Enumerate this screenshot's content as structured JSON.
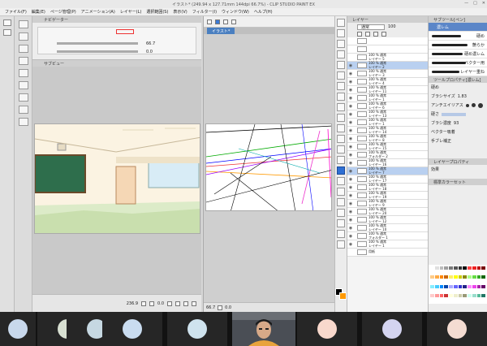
{
  "window": {
    "title": "イラスト* (249.94 x 127.71mm 144dpi 66.7%) - CLIP STUDIO PAINT EX",
    "controls": [
      "—",
      "□",
      "✕"
    ]
  },
  "menu": [
    "ファイル(F)",
    "編集(E)",
    "ページ管理(P)",
    "アニメーション(A)",
    "レイヤー(L)",
    "選択範囲(S)",
    "表示(V)",
    "フィルター(I)",
    "ウィンドウ(W)",
    "ヘルプ(H)"
  ],
  "navigator": {
    "tab_label": "ナビゲーター",
    "zoom_value": "66.7",
    "rotate_value": "0.0"
  },
  "sub_view": {
    "tab_label": "サブビュー",
    "zoom_value": "236.9",
    "rotate_value": "0.0"
  },
  "canvas": {
    "tab_label": "イラスト*",
    "zoom_value": "66.7",
    "rotate_value": "0.0"
  },
  "layers": {
    "panel_label": "レイヤー",
    "blend_mode": "通常",
    "opacity": "100",
    "rows": [
      {
        "eye": "",
        "icon": "",
        "text": ""
      },
      {
        "eye": "",
        "icon": "",
        "text": ""
      },
      {
        "eye": "",
        "icon": "",
        "text": "100 % 通常\nレイヤー 5",
        "sel": false
      },
      {
        "eye": "◉",
        "icon": "",
        "text": "100 % 通常\nレイヤー 2",
        "sel": true
      },
      {
        "eye": "◉",
        "icon": "",
        "text": "100 % 通常\nレイヤー 3",
        "sel": false
      },
      {
        "eye": "◉",
        "icon": "",
        "text": "100 % 通常\nレイヤー 4",
        "sel": false
      },
      {
        "eye": "◉",
        "icon": "",
        "text": "100 % 通常\nレイヤー 11",
        "sel": false
      },
      {
        "eye": "◉",
        "icon": "",
        "text": "100 % 通常\nレイヤー 1",
        "sel": false
      },
      {
        "eye": "◉",
        "icon": "",
        "text": "100 % 通常\nレイヤー 6",
        "sel": false
      },
      {
        "eye": "◉",
        "icon": "",
        "text": "100 % 通常\nレイヤー 13",
        "sel": false
      },
      {
        "eye": "◉",
        "icon": "",
        "text": "100 % 通常\nレイヤー 1",
        "sel": false
      },
      {
        "eye": "◉",
        "icon": "",
        "text": "100 % 通常\nレイヤー 14",
        "sel": false
      },
      {
        "eye": "◉",
        "icon": "",
        "text": "100 % 通常\nレイヤー 8",
        "sel": false
      },
      {
        "eye": "◉",
        "icon": "",
        "text": "100 % 通常\nレイヤー 15",
        "sel": false
      },
      {
        "eye": "◉",
        "icon": "",
        "text": "100 % 通常\nフォルダー 2",
        "sel": false
      },
      {
        "eye": "◉",
        "icon": "",
        "text": "100 % 通常\nレイヤー 16",
        "sel": false
      },
      {
        "eye": "◉",
        "icon": "",
        "text": "100 % 通常\nレイヤー 7",
        "sel": true
      },
      {
        "eye": "◉",
        "icon": "",
        "text": "100 % 通常\nレイヤー 17",
        "sel": false
      },
      {
        "eye": "◉",
        "icon": "",
        "text": "100 % 通常\nレイヤー 18",
        "sel": false
      },
      {
        "eye": "◉",
        "icon": "",
        "text": "100 % 通常\nレイヤー 19",
        "sel": false
      },
      {
        "eye": "◉",
        "icon": "",
        "text": "100 % 通常\nレイヤー 9",
        "sel": false
      },
      {
        "eye": "◉",
        "icon": "",
        "text": "100 % 通常\nレイヤー 20",
        "sel": false
      },
      {
        "eye": "◉",
        "icon": "",
        "text": "100 % 通常\nレイヤー 12",
        "sel": false
      },
      {
        "eye": "◉",
        "icon": "",
        "text": "100 % 通常\nレイヤー 10",
        "sel": false
      },
      {
        "eye": "◉",
        "icon": "",
        "text": "100 % 通常\nフォルダー 1",
        "sel": false
      },
      {
        "eye": "◉",
        "icon": "",
        "text": "100 % 通常\nレイヤー 1",
        "sel": false
      },
      {
        "eye": "",
        "icon": "",
        "text": "用紙",
        "sel": false
      }
    ]
  },
  "sub_tool": {
    "panel_label": "サブツール[ペン]",
    "brushes": [
      {
        "label": "濃レム",
        "sel": true
      },
      {
        "label": "硬め",
        "sel": false
      },
      {
        "label": "艶らか",
        "sel": false
      },
      {
        "label": "硬め濃レム",
        "sel": false
      },
      {
        "label": "ベクター用",
        "sel": false
      },
      {
        "label": "レイヤー重ね",
        "sel": false
      }
    ]
  },
  "tool_property": {
    "panel_label": "ツールプロパティ[濃レム]",
    "brush_name": "硬め",
    "brush_size_label": "ブラシサイズ",
    "brush_size_value": "1.83",
    "aa_label": "アンチエイリアス",
    "hardness_label": "硬さ",
    "density_label": "ブラシ濃度",
    "density_value": "93",
    "vector_label": "ベクター吸着",
    "stabilize_label": "手ブレ補正"
  },
  "layer_property": {
    "panel_label": "レイヤープロパティ",
    "effect_label": "効果"
  },
  "color_set": {
    "panel_label": "標準カラーセット",
    "swatch_colors": [
      "#ffffff",
      "#e0e0e0",
      "#bdbdbd",
      "#9e9e9e",
      "#7a7a7a",
      "#555",
      "#333",
      "#000",
      "#f44",
      "#e22",
      "#b00",
      "#700",
      "#fc8",
      "#fa4",
      "#f80",
      "#c60",
      "#fe6",
      "#ff0",
      "#cc0",
      "#880",
      "#af8",
      "#6d4",
      "#3a2",
      "#160",
      "#8ef",
      "#4cf",
      "#08f",
      "#04a",
      "#aaf",
      "#66f",
      "#33c",
      "#228",
      "#f8f",
      "#e4e",
      "#a2a",
      "#606",
      "#fcc",
      "#f99",
      "#f66",
      "#c33",
      "#ffd",
      "#eec",
      "#cca",
      "#997",
      "#cfe",
      "#9dc",
      "#5b9",
      "#276"
    ]
  },
  "colors": {
    "accent": "#2e6fd4",
    "selected_layer": "#b9d0f0",
    "chalkboard": "#2e6e4c"
  },
  "taskbar": {
    "tiles": [
      {
        "color": "#c8d8ec"
      },
      {
        "color": "#d8e0d2"
      },
      {
        "color": "#c6d8e2"
      },
      {
        "color": "#c9dcf0"
      },
      {
        "color": "#cfe3ee"
      },
      {
        "color": "#f8d8cc"
      },
      {
        "color": "#d4d4f0"
      },
      {
        "color": "#f4dcd2"
      }
    ]
  }
}
